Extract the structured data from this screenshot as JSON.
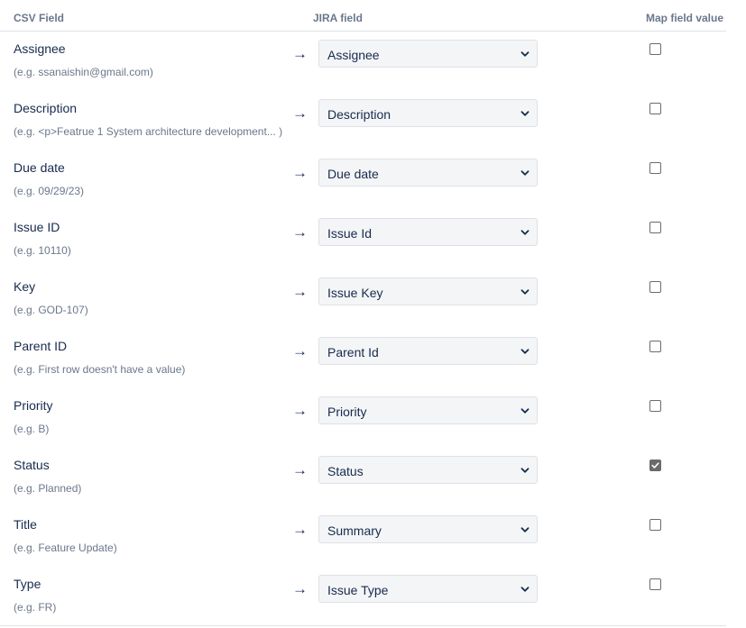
{
  "headers": {
    "csv_field": "CSV Field",
    "jira_field": "JIRA field",
    "map_field_value": "Map field value"
  },
  "arrow_glyph": "→",
  "rows": [
    {
      "csv_field": "Assignee",
      "example": "(e.g. ssanaishin@gmail.com)",
      "jira_field": "Assignee",
      "map_value": false
    },
    {
      "csv_field": "Description",
      "example": "(e.g. <p>Featrue 1 System architecture development... )",
      "jira_field": "Description",
      "map_value": false
    },
    {
      "csv_field": "Due date",
      "example": "(e.g. 09/29/23)",
      "jira_field": "Due date",
      "map_value": false
    },
    {
      "csv_field": "Issue ID",
      "example": "(e.g. 10110)",
      "jira_field": "Issue Id",
      "map_value": false
    },
    {
      "csv_field": "Key",
      "example": "(e.g. GOD-107)",
      "jira_field": "Issue Key",
      "map_value": false
    },
    {
      "csv_field": "Parent ID",
      "example": "(e.g. First row doesn't have a value)",
      "jira_field": "Parent Id",
      "map_value": false
    },
    {
      "csv_field": "Priority",
      "example": "(e.g. B)",
      "jira_field": "Priority",
      "map_value": false
    },
    {
      "csv_field": "Status",
      "example": "(e.g. Planned)",
      "jira_field": "Status",
      "map_value": true
    },
    {
      "csv_field": "Title",
      "example": "(e.g. Feature Update)",
      "jira_field": "Summary",
      "map_value": false
    },
    {
      "csv_field": "Type",
      "example": "(e.g. FR)",
      "jira_field": "Issue Type",
      "map_value": false
    }
  ],
  "icons": {
    "dropdown": "chevron-down-icon",
    "arrow": "right-arrow-icon",
    "check": "checkmark-icon"
  },
  "colors": {
    "text": "#172b4d",
    "muted": "#6b778c",
    "select_bg": "#f4f5f7",
    "border": "#dfe1e6",
    "checkbox_checked": "#6b6b6b"
  }
}
